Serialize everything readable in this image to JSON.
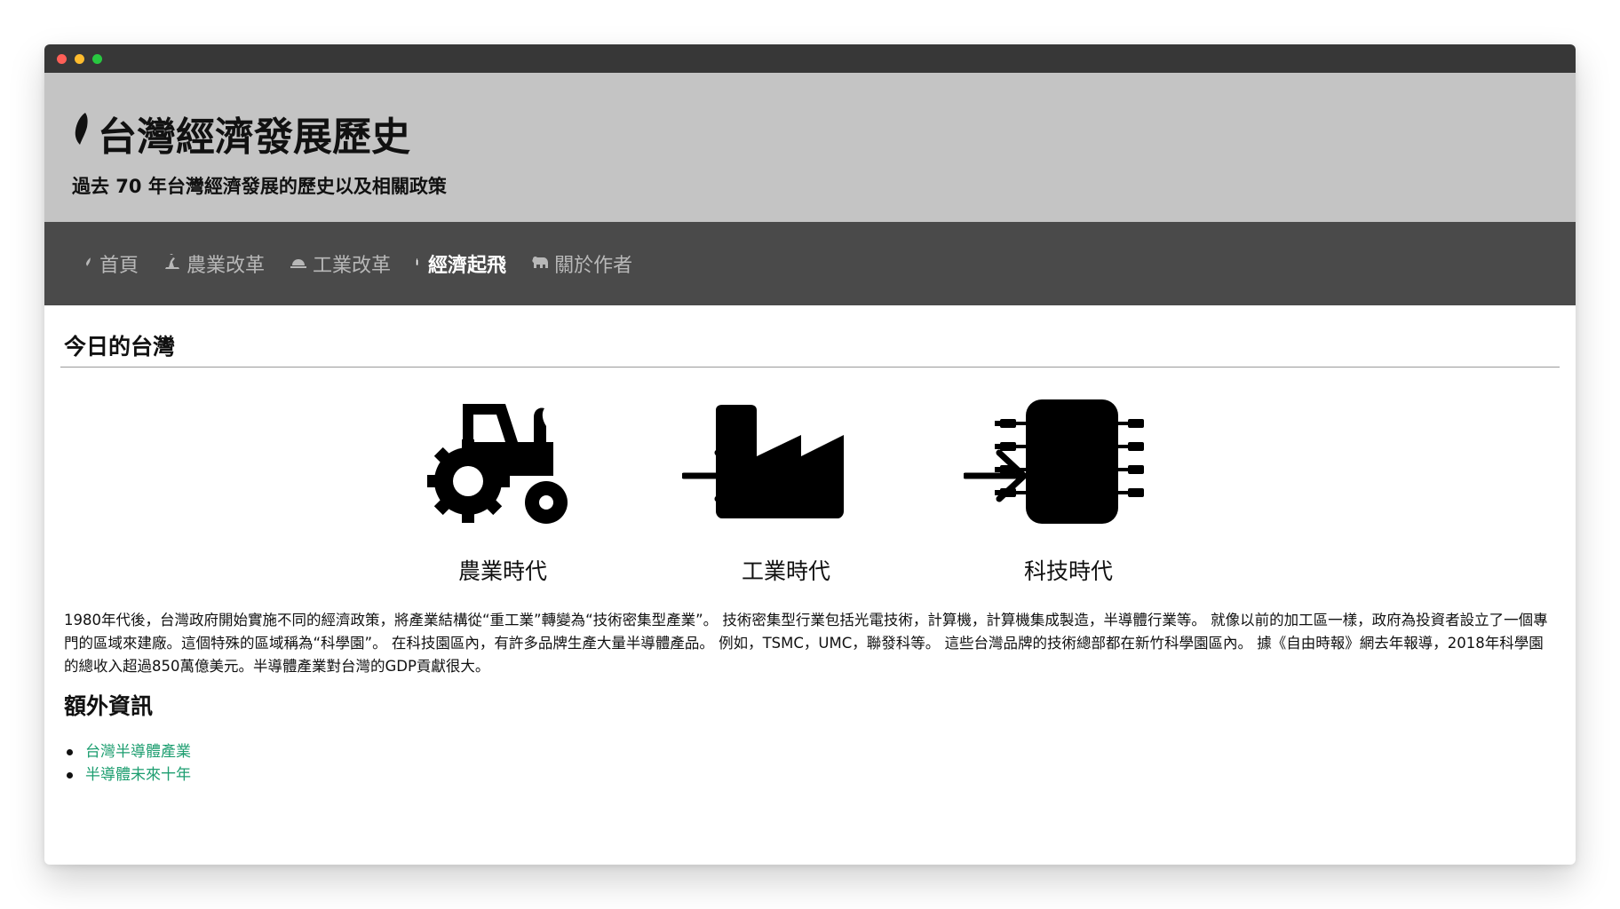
{
  "window": {
    "controls": [
      "close",
      "minimize",
      "maximize"
    ]
  },
  "header": {
    "title": "台灣經濟發展歷史",
    "title_icon": "taiwan-island-icon",
    "subtitle": "過去 70 年台灣經濟發展的歷史以及相關政策"
  },
  "nav": {
    "items": [
      {
        "label": "首頁",
        "icon": "taiwan-island-icon",
        "active": false
      },
      {
        "label": "農業改革",
        "icon": "farmer-icon",
        "active": false
      },
      {
        "label": "工業改革",
        "icon": "factory-icon",
        "active": false
      },
      {
        "label": "經濟起飛",
        "icon": "tower-icon",
        "active": true
      },
      {
        "label": "關於作者",
        "icon": "bear-icon",
        "active": false
      }
    ]
  },
  "main": {
    "section_title": "今日的台灣",
    "eras": [
      {
        "label": "農業時代",
        "icon": "tractor-icon"
      },
      {
        "label": "工業時代",
        "icon": "factory-icon"
      },
      {
        "label": "科技時代",
        "icon": "microchip-icon"
      }
    ],
    "paragraph": "1980年代後，台灣政府開始實施不同的經濟政策，將產業結構從“重工業”轉變為“技術密集型產業”。 技術密集型行業包括光電技術，計算機，計算機集成製造，半導體行業等。 就像以前的加工區一樣，政府為投資者設立了一個專門的區域來建廠。這個特殊的區域稱為“科學園”。 在科技園區內，有許多品牌生產大量半導體產品。 例如，TSMC，UMC，聯發科等。 這些台灣品牌的技術總部都在新竹科學園區內。 據《自由時報》網去年報導，2018年科學園的總收入超過850萬億美元。半導體產業對台灣的GDP貢獻很大。",
    "extra_title": "額外資訊",
    "links": [
      {
        "label": "台灣半導體產業"
      },
      {
        "label": "半導體未來十年"
      }
    ]
  },
  "colors": {
    "titlebar": "#373737",
    "banner": "#c4c4c4",
    "navbar": "#4a4a4a",
    "nav_inactive": "#b8b8b8",
    "nav_active": "#ffffff",
    "link": "#1d9e70"
  }
}
